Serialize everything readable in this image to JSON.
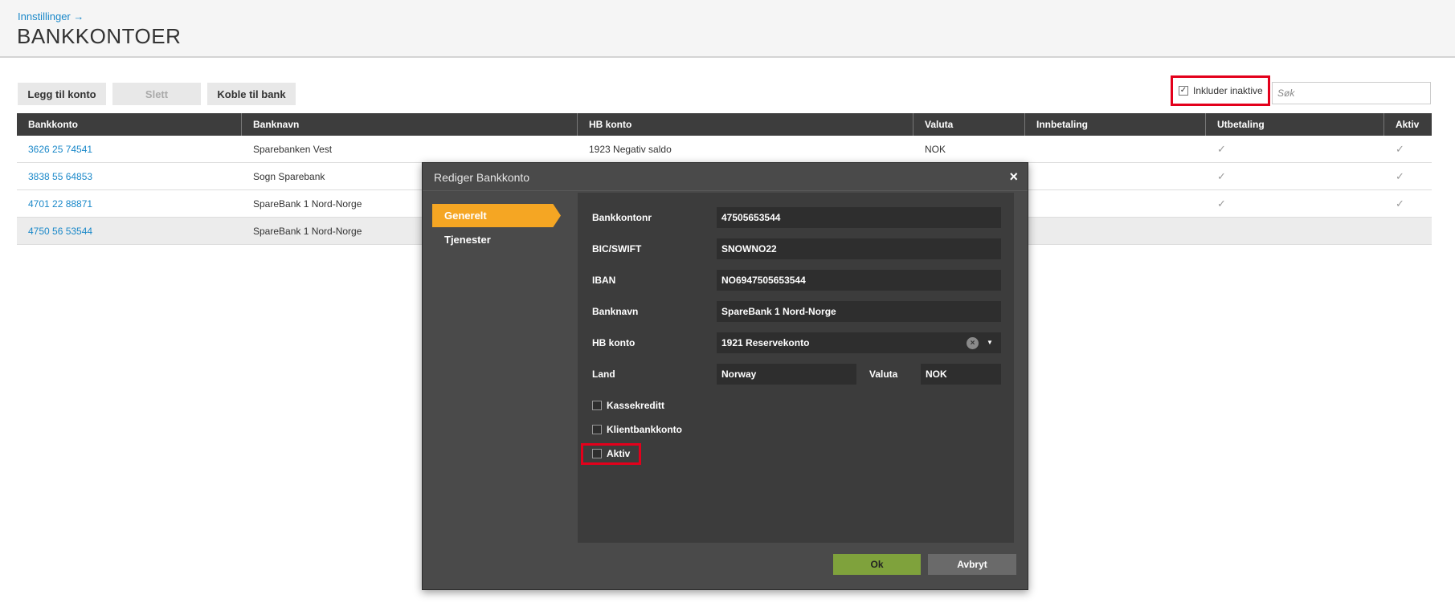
{
  "header": {
    "breadcrumb": "Innstillinger →",
    "title": "BANKKONTOER"
  },
  "toolbar": {
    "add_label": "Legg til konto",
    "delete_label": "Slett",
    "connect_label": "Koble til bank"
  },
  "filter": {
    "include_inactive_label": "Inkluder inaktive",
    "include_inactive_checked": true,
    "search_placeholder": "Søk"
  },
  "table": {
    "columns": [
      "Bankkonto",
      "Banknavn",
      "HB konto",
      "Valuta",
      "Innbetaling",
      "Utbetaling",
      "Aktiv"
    ],
    "rows": [
      {
        "bankkonto": "3626 25 74541",
        "banknavn": "Sparebanken Vest",
        "hb_konto": "1923 Negativ saldo",
        "valuta": "NOK",
        "innbetaling": "",
        "utbetaling": "✓",
        "aktiv": "✓"
      },
      {
        "bankkonto": "3838 55 64853",
        "banknavn": "Sogn Sparebank",
        "hb_konto": "",
        "valuta": "",
        "innbetaling": "",
        "utbetaling": "✓",
        "aktiv": "✓"
      },
      {
        "bankkonto": "4701 22 88871",
        "banknavn": "SpareBank 1 Nord-Norge",
        "hb_konto": "",
        "valuta": "",
        "innbetaling": "",
        "utbetaling": "✓",
        "aktiv": "✓"
      },
      {
        "bankkonto": "4750 56 53544",
        "banknavn": "SpareBank 1 Nord-Norge",
        "hb_konto": "",
        "valuta": "",
        "innbetaling": "",
        "utbetaling": "",
        "aktiv": ""
      }
    ]
  },
  "dialog": {
    "title": "Rediger Bankkonto",
    "close_glyph": "×",
    "tabs": [
      "Generelt",
      "Tjenester"
    ],
    "active_tab": "Generelt",
    "fields": {
      "bankkontonr": {
        "label": "Bankkontonr",
        "value": "47505653544"
      },
      "bic": {
        "label": "BIC/SWIFT",
        "value": "SNOWNO22"
      },
      "iban": {
        "label": "IBAN",
        "value": "NO6947505653544"
      },
      "banknavn": {
        "label": "Banknavn",
        "value": "SpareBank 1 Nord-Norge"
      },
      "hb_konto": {
        "label": "HB konto",
        "value": "1921 Reservekonto"
      },
      "land": {
        "label": "Land",
        "value": "Norway"
      },
      "valuta": {
        "label": "Valuta",
        "value": "NOK"
      }
    },
    "checkboxes": [
      {
        "label": "Kassekreditt",
        "checked": false
      },
      {
        "label": "Klientbankkonto",
        "checked": false
      },
      {
        "label": "Aktiv",
        "checked": false
      }
    ],
    "ok_label": "Ok",
    "cancel_label": "Avbryt"
  },
  "colors": {
    "accent_tab": "#f5a623",
    "ok_button": "#7fa23c",
    "link": "#1a88c9",
    "highlight": "#e3001b",
    "grid_header": "#3d3d3d",
    "dialog_bg": "#4a4a4a"
  }
}
